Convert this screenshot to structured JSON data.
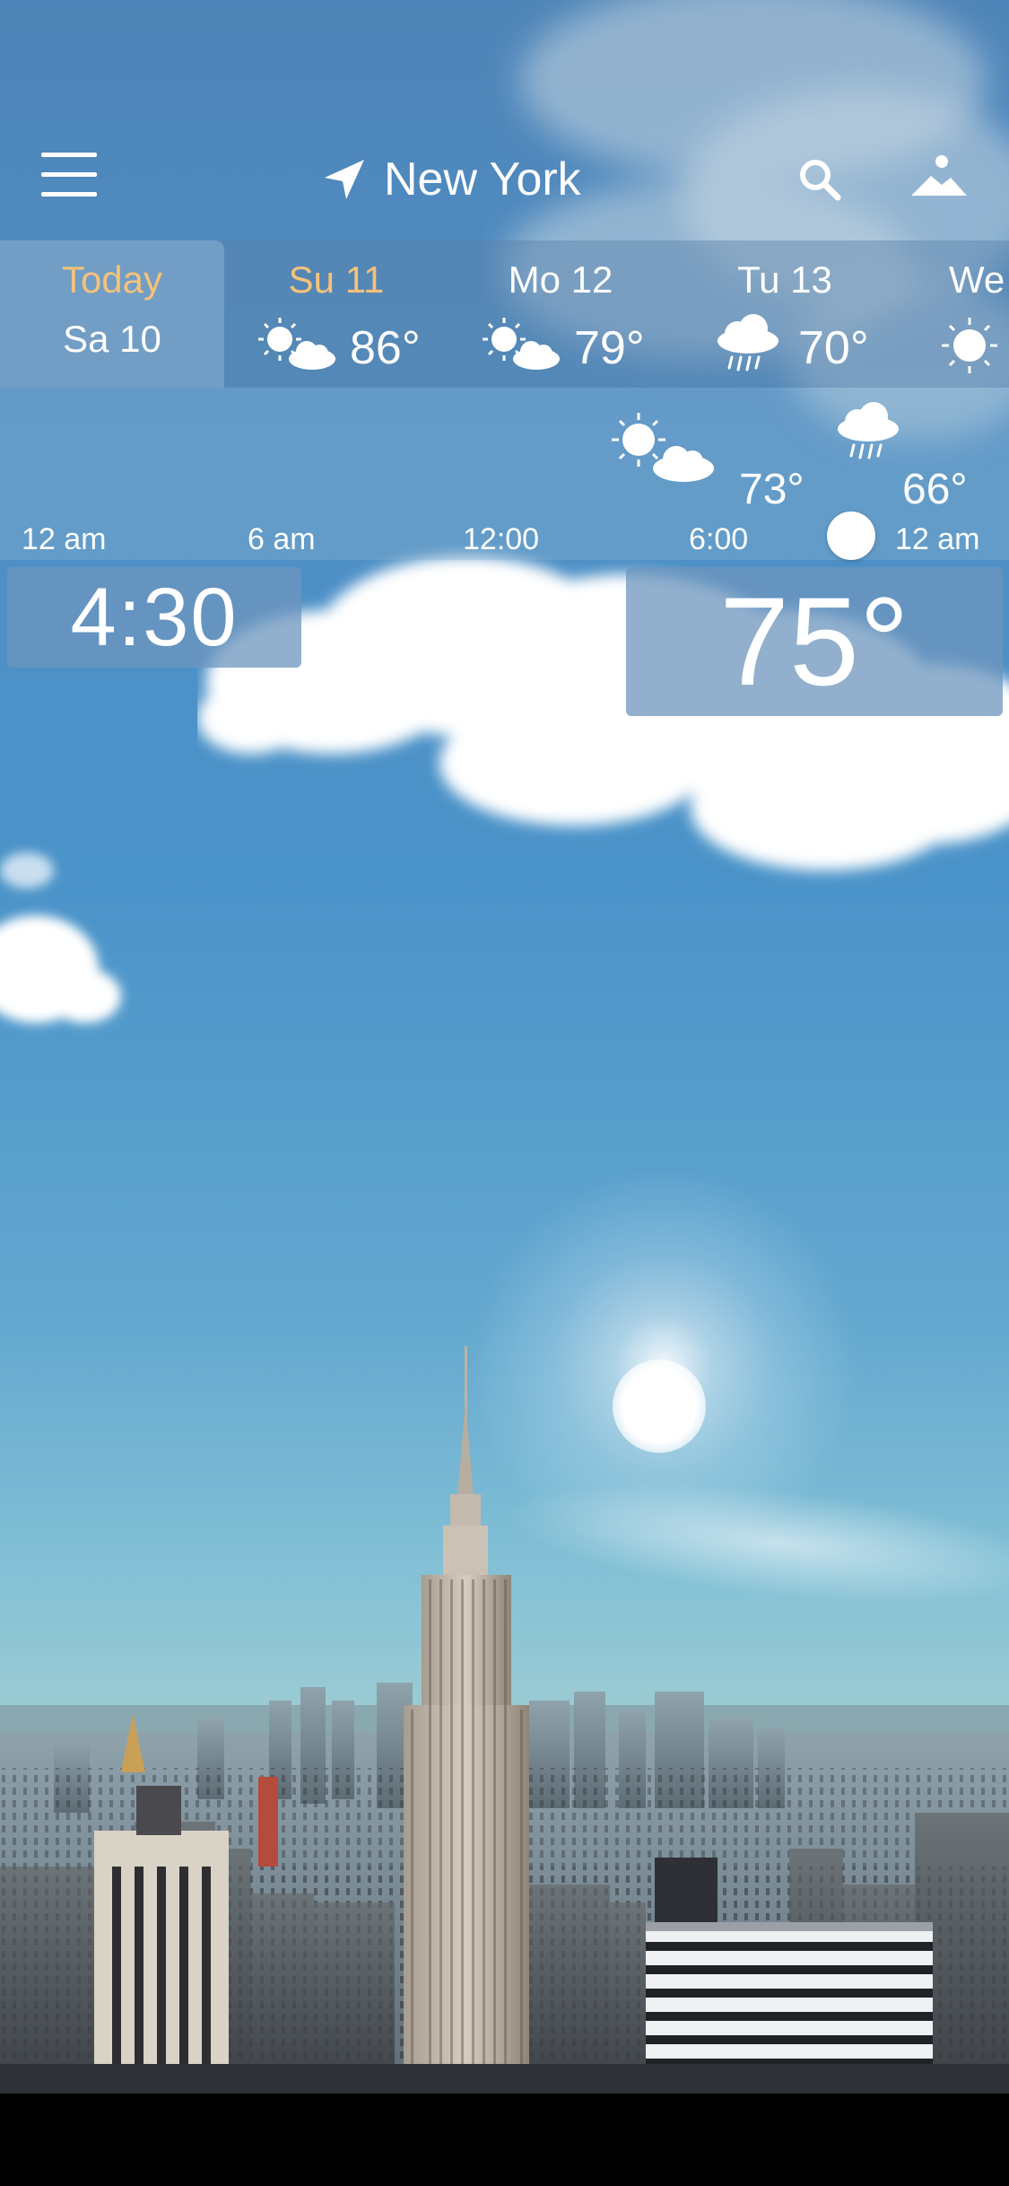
{
  "header": {
    "location": "New York",
    "icons": [
      "menu-icon",
      "location-arrow-icon",
      "search-icon",
      "landscape-icon"
    ]
  },
  "days": [
    {
      "label": "Today",
      "sub": "Sa 10",
      "selected": true
    },
    {
      "label": "Su 11",
      "icon": "sun-cloud-icon",
      "temp": "86°"
    },
    {
      "label": "Mo 12",
      "icon": "sun-cloud-icon",
      "temp": "79°"
    },
    {
      "label": "Tu 13",
      "icon": "rain-cloud-icon",
      "temp": "70°"
    },
    {
      "label": "We",
      "icon": "sun-icon",
      "temp": ""
    }
  ],
  "hourly": {
    "entries": [
      {
        "icon": "sun-cloud-icon",
        "temp": "73°"
      },
      {
        "icon": "rain-cloud-icon",
        "temp": "66°"
      }
    ],
    "ticks": [
      "12 am",
      "6 am",
      "12:00",
      "6:00",
      "12 am"
    ]
  },
  "current": {
    "time": "4:30",
    "temperature": "75°"
  },
  "colors": {
    "accent_orange": "#f5c27a",
    "panel_blue": "#6e96be",
    "text": "#ffffff"
  }
}
